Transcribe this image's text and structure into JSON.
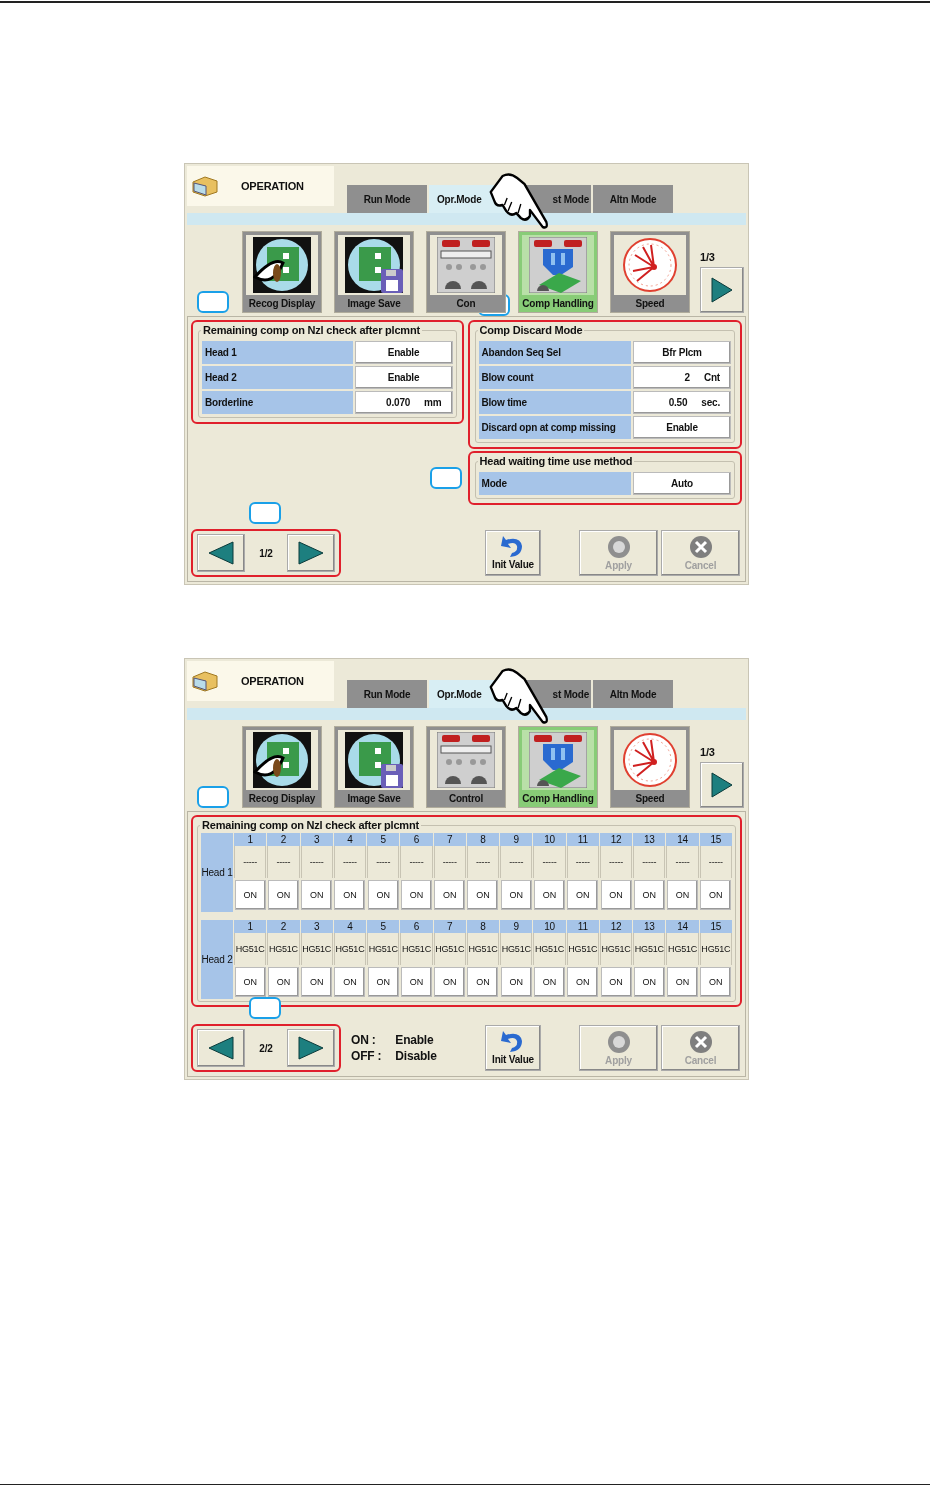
{
  "screens": [
    {
      "title": "OPERATION",
      "tabs": [
        {
          "label": "Run Mode",
          "selected": false
        },
        {
          "label": "Opr.Mode",
          "selected": true
        },
        {
          "label": "st Mode",
          "selected": false
        },
        {
          "label": "Altn Mode",
          "selected": false
        }
      ],
      "function_bar_callout": true,
      "functions": [
        {
          "label": "Recog Display",
          "selected": false,
          "callout": false
        },
        {
          "label": "Image Save",
          "selected": false,
          "callout": false
        },
        {
          "label": "Con",
          "selected": false,
          "callout": true
        },
        {
          "label": "Comp Handling",
          "selected": true,
          "callout": false
        },
        {
          "label": "Speed",
          "selected": false,
          "callout": false
        }
      ],
      "function_page": "1/3",
      "content": {
        "kind": "settings",
        "columns": [
          [
            {
              "title": "Remaining comp on Nzl check after plcmnt",
              "highlighted": true,
              "callout": false,
              "rows": [
                {
                  "label": "Head 1",
                  "value": "Enable"
                },
                {
                  "label": "Head 2",
                  "value": "Enable"
                },
                {
                  "label": "Borderline",
                  "value": "0.070",
                  "unit": "mm"
                }
              ]
            }
          ],
          [
            {
              "title": "Comp Discard Mode",
              "highlighted": true,
              "callout": false,
              "rows": [
                {
                  "label": "Abandon Seq Sel",
                  "value": "Bfr Plcm"
                },
                {
                  "label": "Blow count",
                  "value": "2",
                  "unit": "Cnt"
                },
                {
                  "label": "Blow time",
                  "value": "0.50",
                  "unit": "sec."
                },
                {
                  "label": "Discard opn at comp missing",
                  "value": "Enable"
                }
              ]
            },
            {
              "title": "Head waiting time use method",
              "highlighted": true,
              "callout": true,
              "rows": [
                {
                  "label": "Mode",
                  "value": "Auto"
                }
              ]
            }
          ]
        ]
      },
      "page": {
        "label": "1/2",
        "highlighted": true,
        "callout": true
      },
      "actions": [
        {
          "label": "Init Value",
          "disabled": false
        },
        {
          "label": "Apply",
          "disabled": true
        },
        {
          "label": "Cancel",
          "disabled": true
        }
      ]
    },
    {
      "title": "OPERATION",
      "tabs": [
        {
          "label": "Run Mode",
          "selected": false
        },
        {
          "label": "Opr.Mode",
          "selected": true
        },
        {
          "label": "st Mode",
          "selected": false
        },
        {
          "label": "Altn Mode",
          "selected": false
        }
      ],
      "function_bar_callout": true,
      "functions": [
        {
          "label": "Recog Display",
          "selected": false,
          "callout": false
        },
        {
          "label": "Image Save",
          "selected": false,
          "callout": false
        },
        {
          "label": "Control",
          "selected": false,
          "callout": false
        },
        {
          "label": "Comp Handling",
          "selected": true,
          "callout": false
        },
        {
          "label": "Speed",
          "selected": false,
          "callout": false
        }
      ],
      "function_page": "1/3",
      "content": {
        "kind": "nozzle_grid",
        "title": "Remaining comp on Nzl check after plcmnt",
        "highlighted": true,
        "heads": [
          {
            "label": "Head 1",
            "nozzles": [
              {
                "number": "1",
                "type": "-----",
                "state": "ON"
              },
              {
                "number": "2",
                "type": "-----",
                "state": "ON"
              },
              {
                "number": "3",
                "type": "-----",
                "state": "ON"
              },
              {
                "number": "4",
                "type": "-----",
                "state": "ON"
              },
              {
                "number": "5",
                "type": "-----",
                "state": "ON"
              },
              {
                "number": "6",
                "type": "-----",
                "state": "ON"
              },
              {
                "number": "7",
                "type": "-----",
                "state": "ON"
              },
              {
                "number": "8",
                "type": "-----",
                "state": "ON"
              },
              {
                "number": "9",
                "type": "-----",
                "state": "ON"
              },
              {
                "number": "10",
                "type": "-----",
                "state": "ON"
              },
              {
                "number": "11",
                "type": "-----",
                "state": "ON"
              },
              {
                "number": "12",
                "type": "-----",
                "state": "ON"
              },
              {
                "number": "13",
                "type": "-----",
                "state": "ON"
              },
              {
                "number": "14",
                "type": "-----",
                "state": "ON"
              },
              {
                "number": "15",
                "type": "-----",
                "state": "ON"
              }
            ]
          },
          {
            "label": "Head 2",
            "nozzles": [
              {
                "number": "1",
                "type": "HG51C",
                "state": "ON"
              },
              {
                "number": "2",
                "type": "HG51C",
                "state": "ON"
              },
              {
                "number": "3",
                "type": "HG51C",
                "state": "ON"
              },
              {
                "number": "4",
                "type": "HG51C",
                "state": "ON"
              },
              {
                "number": "5",
                "type": "HG51C",
                "state": "ON"
              },
              {
                "number": "6",
                "type": "HG51C",
                "state": "ON"
              },
              {
                "number": "7",
                "type": "HG51C",
                "state": "ON"
              },
              {
                "number": "8",
                "type": "HG51C",
                "state": "ON"
              },
              {
                "number": "9",
                "type": "HG51C",
                "state": "ON"
              },
              {
                "number": "10",
                "type": "HG51C",
                "state": "ON"
              },
              {
                "number": "11",
                "type": "HG51C",
                "state": "ON"
              },
              {
                "number": "12",
                "type": "HG51C",
                "state": "ON"
              },
              {
                "number": "13",
                "type": "HG51C",
                "state": "ON"
              },
              {
                "number": "14",
                "type": "HG51C",
                "state": "ON"
              },
              {
                "number": "15",
                "type": "HG51C",
                "state": "ON"
              }
            ]
          }
        ]
      },
      "page": {
        "label": "2/2",
        "highlighted": true,
        "callout": true
      },
      "legend": [
        {
          "key": "ON :",
          "meaning": "Enable"
        },
        {
          "key": "OFF :",
          "meaning": "Disable"
        }
      ],
      "actions": [
        {
          "label": "Init Value",
          "disabled": false
        },
        {
          "label": "Apply",
          "disabled": true
        },
        {
          "label": "Cancel",
          "disabled": true
        }
      ]
    }
  ]
}
